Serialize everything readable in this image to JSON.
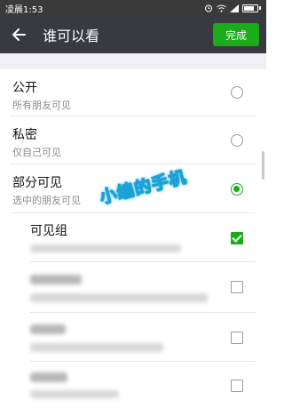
{
  "status_bar": {
    "time": "凌晨1:53"
  },
  "header": {
    "title": "谁可以看",
    "done_label": "完成",
    "back_icon": "arrow-left-icon"
  },
  "options": [
    {
      "title": "公开",
      "subtitle": "所有朋友可见",
      "selected": false
    },
    {
      "title": "私密",
      "subtitle": "仅自己可见",
      "selected": false
    },
    {
      "title": "部分可见",
      "subtitle": "选中的朋友可见",
      "selected": true
    }
  ],
  "groups": [
    {
      "name": "可见组",
      "checked": true
    },
    {
      "name": "",
      "checked": false
    },
    {
      "name": "",
      "checked": false
    },
    {
      "name": "",
      "checked": false
    }
  ],
  "watermark": {
    "text": "小编的手机"
  },
  "colors": {
    "accent": "#1aad19",
    "appbar": "#393a3f",
    "statusbar": "#3a3a3a"
  }
}
